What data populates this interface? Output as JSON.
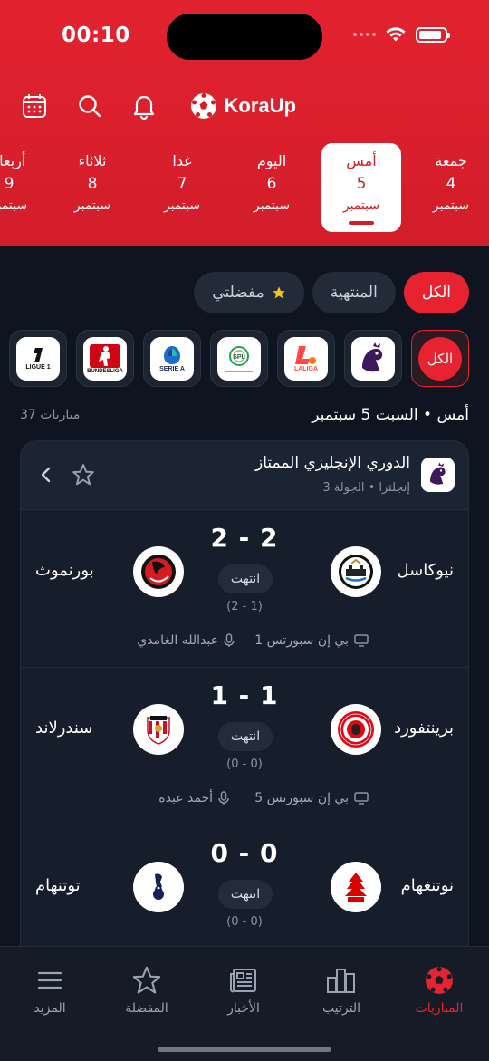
{
  "status_bar": {
    "time": "00:10"
  },
  "header": {
    "app_name": "KoraUp"
  },
  "dates": [
    {
      "day": "أربعاء",
      "num": "9",
      "month": "سبتمبر"
    },
    {
      "day": "ثلاثاء",
      "num": "8",
      "month": "سبتمبر"
    },
    {
      "day": "غدا",
      "num": "7",
      "month": "سبتمبر"
    },
    {
      "day": "اليوم",
      "num": "6",
      "month": "سبتمبر"
    },
    {
      "day": "أمس",
      "num": "5",
      "month": "سبتمبر"
    },
    {
      "day": "جمعة",
      "num": "4",
      "month": "سبتمبر"
    }
  ],
  "filters": {
    "all": "الكل",
    "finished": "المنتهية",
    "favorites": "مفضلتي"
  },
  "leagues": {
    "all_label": "الكل",
    "laliga": "LALIGA",
    "seriea": "SERIE A",
    "bundesliga": "BUNDESLIGA",
    "ligue1": "LIGUE 1",
    "spl": "SPL"
  },
  "day_header": {
    "title": "أمس • السبت 5 سبتمبر",
    "count": "37 مباريات"
  },
  "competition": {
    "name": "الدوري الإنجليزي الممتاز",
    "sub": "إنجلترا • الجولة 3"
  },
  "matches": [
    {
      "home": "نيوكاسل",
      "away": "بورنموث",
      "score": "2 - 2",
      "status": "انتهت",
      "ht": "(2 - 1)",
      "tv": "بي إن سبورتس 1",
      "referee": "عبدالله الغامدي"
    },
    {
      "home": "برينتفورد",
      "away": "سندرلاند",
      "score": "1 - 1",
      "status": "انتهت",
      "ht": "(0 - 0)",
      "tv": "بي إن سبورتس 5",
      "referee": "أحمد عبده"
    },
    {
      "home": "نوتنغهام",
      "away": "توتنهام",
      "score": "0 - 0",
      "status": "انتهت",
      "ht": "(0 - 0)"
    }
  ],
  "tabs": {
    "matches": "المباريات",
    "standings": "الترتيب",
    "news": "الأخبار",
    "favorites": "المفضلة",
    "more": "المزيد"
  },
  "colors": {
    "accent": "#e8222f",
    "background": "#0f1520",
    "card": "#161e2b"
  }
}
